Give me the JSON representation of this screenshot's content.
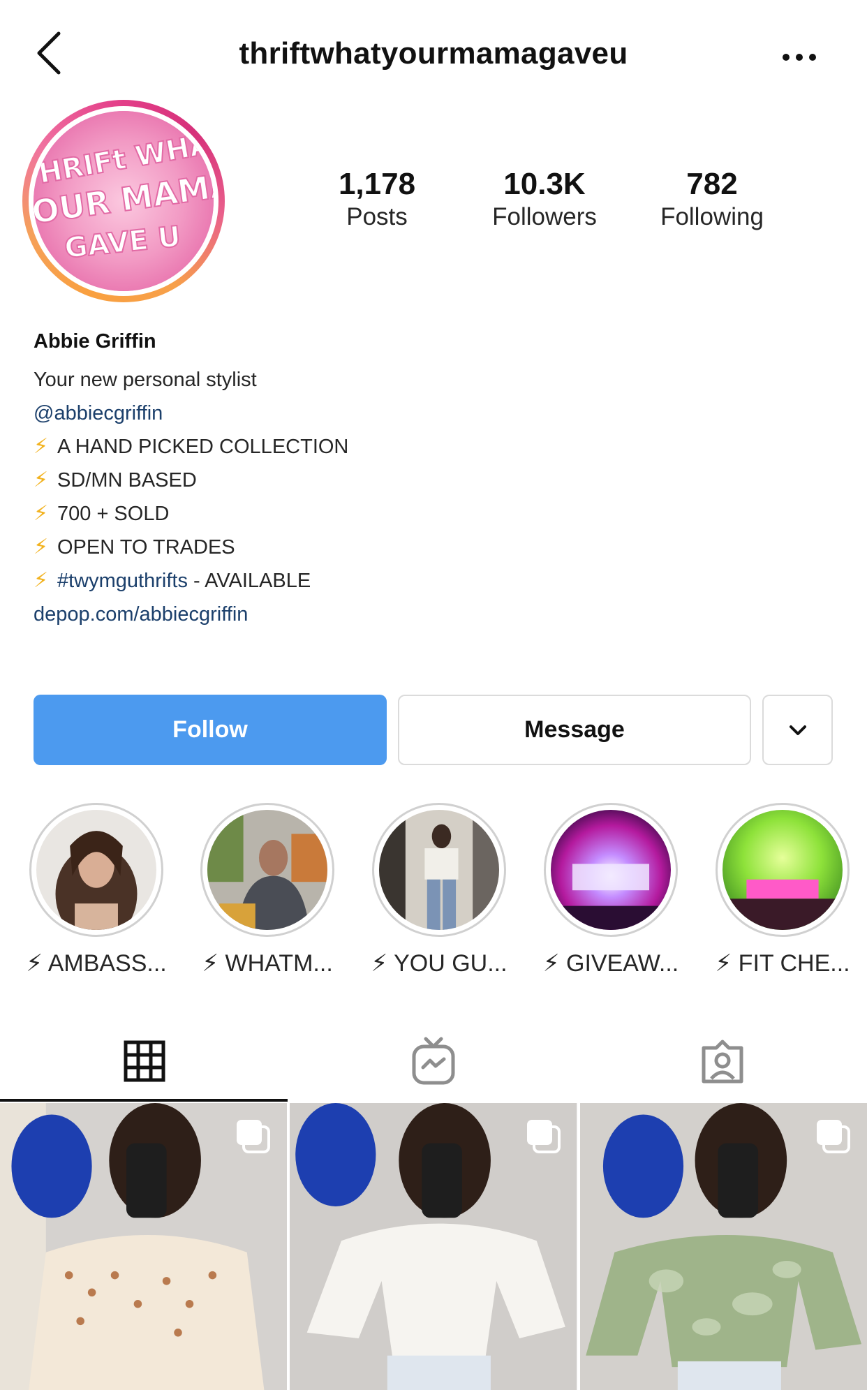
{
  "header": {
    "username": "thriftwhatyourmamagaveu"
  },
  "avatar": {
    "logo_text": [
      "THRIFt WHAt",
      "YOUR MAMA",
      "GAVE U"
    ]
  },
  "stats": [
    {
      "value": "1,178",
      "label": "Posts"
    },
    {
      "value": "10.3K",
      "label": "Followers"
    },
    {
      "value": "782",
      "label": "Following"
    }
  ],
  "bio": {
    "name": "Abbie Griffin",
    "tagline": "Your new personal stylist",
    "mention": "@abbiecgriffin",
    "lines": [
      "A HAND PICKED COLLECTION",
      "SD/MN BASED",
      "700 + SOLD",
      "OPEN TO TRADES"
    ],
    "hashtag": "#twymguthrifts",
    "hashtag_suffix": " - AVAILABLE",
    "website": "depop.com/abbiecgriffin",
    "bolt_glyph": "⚡"
  },
  "buttons": {
    "follow": "Follow",
    "message": "Message"
  },
  "highlights": [
    {
      "label": "⚡ AMBASS..."
    },
    {
      "label": "⚡ WHATM..."
    },
    {
      "label": "⚡ YOU GU..."
    },
    {
      "label": "⚡ GIVEAW..."
    },
    {
      "label": "⚡ FIT CHE..."
    }
  ],
  "tabs": [
    {
      "icon": "grid-icon",
      "active": true
    },
    {
      "icon": "igtv-icon",
      "active": false
    },
    {
      "icon": "tagged-icon",
      "active": false
    }
  ],
  "posts": [
    {
      "icon": "multiple-photos-icon",
      "top_color": "polka-dot blouse"
    },
    {
      "icon": "multiple-photos-icon",
      "top_color": "white bell-sleeve top"
    },
    {
      "icon": "multiple-photos-icon",
      "top_color": "green tie-dye cardigan"
    }
  ],
  "colors": {
    "follow_button": "#4c9aef",
    "link": "#1b3f6b",
    "bolt": "#f2b21e"
  }
}
